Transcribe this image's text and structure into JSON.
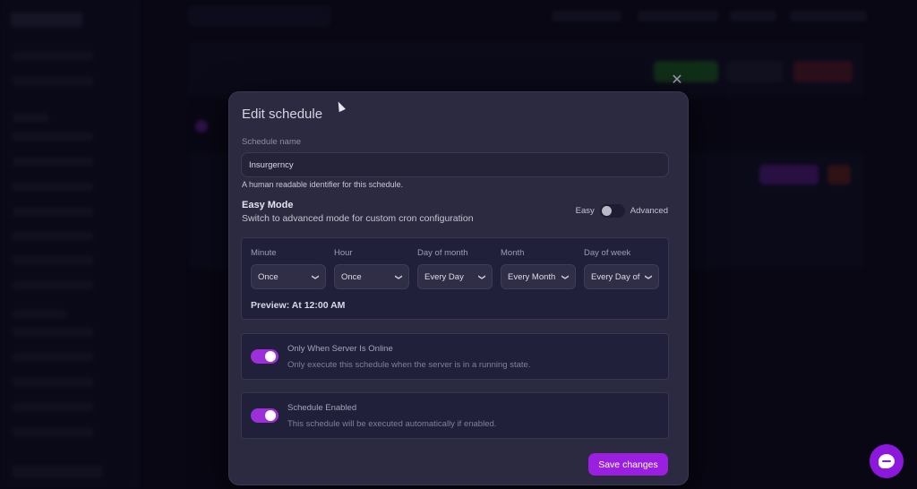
{
  "modal": {
    "title": "Edit schedule",
    "close_icon": "close-icon",
    "name_label": "Schedule name",
    "name_value": "Insurgerncy",
    "name_hint": "A human readable identifier for this schedule.",
    "mode_title": "Easy Mode",
    "mode_subtitle": "Switch to advanced mode for custom cron configuration",
    "mode_easy": "Easy",
    "mode_advanced": "Advanced",
    "mode_is_advanced": false,
    "cron": {
      "minute_label": "Minute",
      "minute_value": "Once",
      "hour_label": "Hour",
      "hour_value": "Once",
      "dom_label": "Day of month",
      "dom_value": "Every Day",
      "month_label": "Month",
      "month_value": "Every Month",
      "dow_label": "Day of week",
      "dow_value": "Every Day of",
      "preview": "Preview: At 12:00 AM"
    },
    "online_only": {
      "enabled": true,
      "title": "Only When Server Is Online",
      "desc": "Only execute this schedule when the server is in a running state."
    },
    "schedule_enabled": {
      "enabled": true,
      "title": "Schedule Enabled",
      "desc": "This schedule will be executed automatically if enabled."
    },
    "save_label": "Save changes"
  },
  "colors": {
    "accent": "#9b1fe0",
    "modal_bg": "#2b2a40",
    "page_bg": "#0b0a18"
  },
  "chat_icon": "chat-icon"
}
